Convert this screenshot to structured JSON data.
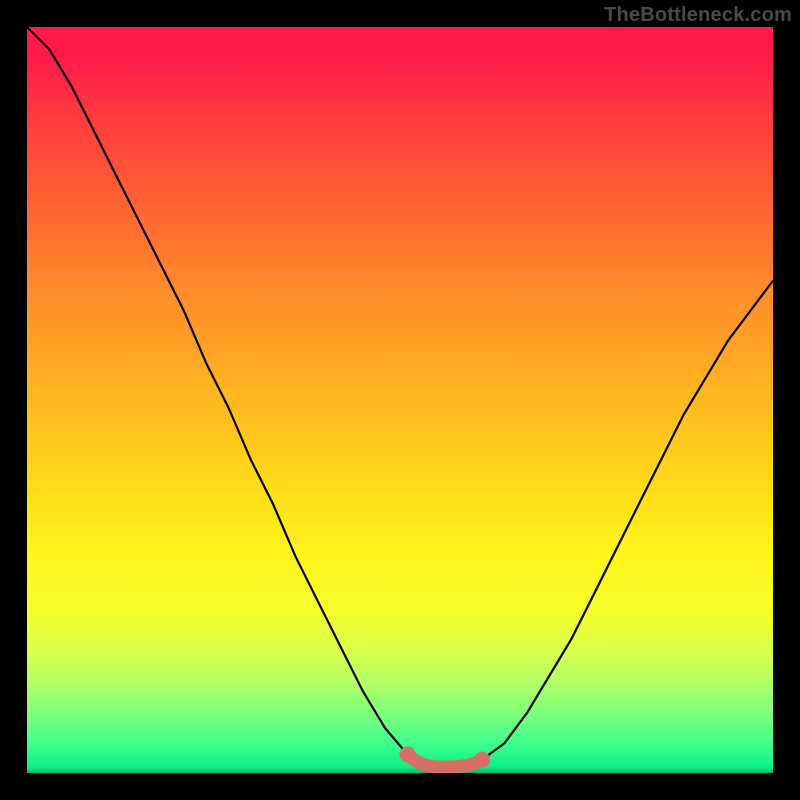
{
  "watermark": {
    "text": "TheBottleneck.com"
  },
  "chart_data": {
    "type": "line",
    "title": "",
    "xlabel": "",
    "ylabel": "",
    "xlim": [
      0,
      100
    ],
    "ylim": [
      0,
      100
    ],
    "x": [
      0,
      3,
      6,
      9,
      12,
      15,
      18,
      21,
      24,
      27,
      30,
      33,
      36,
      39,
      42,
      45,
      48,
      51,
      53,
      55,
      57,
      59,
      61,
      64,
      67,
      70,
      73,
      76,
      79,
      82,
      85,
      88,
      91,
      94,
      97,
      100
    ],
    "values": [
      100,
      97,
      92,
      86,
      80,
      74,
      68,
      62,
      55,
      49,
      42,
      36,
      29,
      23,
      17,
      11,
      6,
      2.5,
      1.2,
      0.8,
      0.8,
      1.0,
      1.8,
      4,
      8,
      13,
      18,
      24,
      30,
      36,
      42,
      48,
      53,
      58,
      62,
      66
    ],
    "series": [
      {
        "name": "curve",
        "color": "#000000",
        "x": [
          0,
          3,
          6,
          9,
          12,
          15,
          18,
          21,
          24,
          27,
          30,
          33,
          36,
          39,
          42,
          45,
          48,
          51,
          53,
          55,
          57,
          59,
          61,
          64,
          67,
          70,
          73,
          76,
          79,
          82,
          85,
          88,
          91,
          94,
          97,
          100
        ],
        "y": [
          100,
          97,
          92,
          86,
          80,
          74,
          68,
          62,
          55,
          49,
          42,
          36,
          29,
          23,
          17,
          11,
          6,
          2.5,
          1.2,
          0.8,
          0.8,
          1.0,
          1.8,
          4,
          8,
          13,
          18,
          24,
          30,
          36,
          42,
          48,
          53,
          58,
          62,
          66
        ]
      },
      {
        "name": "highlight-band",
        "color": "#d86f64",
        "x": [
          51,
          52,
          53,
          54,
          55,
          56,
          57,
          58,
          59,
          60,
          61
        ],
        "y": [
          2.5,
          1.7,
          1.2,
          0.9,
          0.8,
          0.8,
          0.8,
          0.9,
          1.0,
          1.3,
          1.8
        ]
      }
    ]
  }
}
